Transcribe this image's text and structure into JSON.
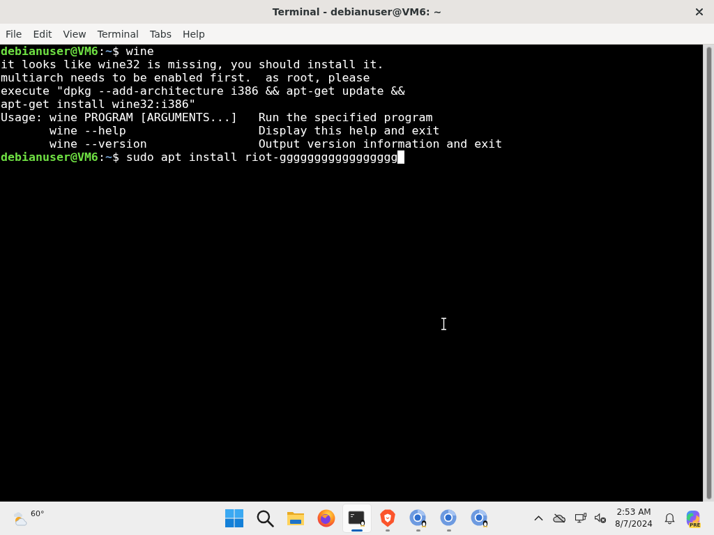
{
  "window": {
    "title": "Terminal - debianuser@VM6: ~"
  },
  "menu": [
    "File",
    "Edit",
    "View",
    "Terminal",
    "Tabs",
    "Help"
  ],
  "terminal": {
    "lines": [
      {
        "kind": "prompt",
        "user_host": "debianuser@VM6",
        "separator": ":",
        "path": "~",
        "symbol": "$",
        "command": "wine",
        "cursor": false
      },
      {
        "kind": "output",
        "text": "it looks like wine32 is missing, you should install it."
      },
      {
        "kind": "output",
        "text": "multiarch needs to be enabled first.  as root, please"
      },
      {
        "kind": "output",
        "text": "execute \"dpkg --add-architecture i386 && apt-get update &&"
      },
      {
        "kind": "output",
        "text": "apt-get install wine32:i386\""
      },
      {
        "kind": "usage",
        "label": "Usage:",
        "syntax": "wine PROGRAM [ARGUMENTS...]",
        "description": "Run the specified program"
      },
      {
        "kind": "usage",
        "syntax": "wine --help",
        "description": "Display this help and exit"
      },
      {
        "kind": "usage",
        "syntax": "wine --version",
        "description": "Output version information and exit"
      },
      {
        "kind": "prompt",
        "user_host": "debianuser@VM6",
        "separator": ":",
        "path": "~",
        "symbol": "$",
        "command": "sudo apt install riot-ggggggggggggggggg",
        "cursor": true
      }
    ]
  },
  "taskbar": {
    "weather": {
      "temperature": "60°"
    },
    "apps": [
      {
        "kind": "start",
        "selected": false,
        "running": false
      },
      {
        "kind": "search",
        "selected": false,
        "running": false
      },
      {
        "kind": "files",
        "selected": false,
        "running": false
      },
      {
        "kind": "firefox",
        "selected": false,
        "running": false
      },
      {
        "kind": "terminal",
        "selected": true,
        "running": true
      },
      {
        "kind": "brave",
        "selected": false,
        "running": true
      },
      {
        "kind": "chrome_app",
        "selected": false,
        "running": true
      },
      {
        "kind": "chrome",
        "selected": false,
        "running": true
      },
      {
        "kind": "chrome_app",
        "selected": false,
        "running": false
      }
    ],
    "tray": {
      "clock_time": "2:53 AM",
      "clock_date": "8/7/2024",
      "badge": "PRE"
    }
  }
}
